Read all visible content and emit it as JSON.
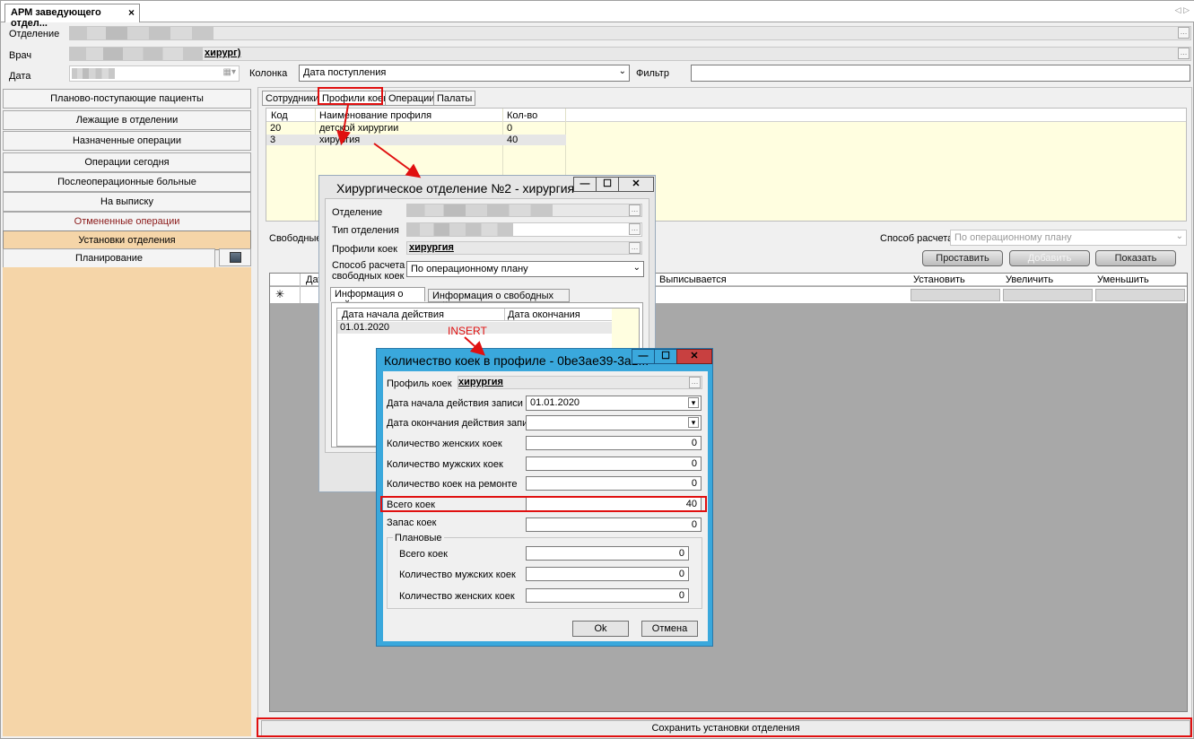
{
  "tab": {
    "title": "АРМ заведующего отдел...",
    "close": "×",
    "nav_arrows": "◁ ▷"
  },
  "filters": {
    "department_label": "Отделение",
    "doctor_label": "Врач",
    "doctor_value": "хирург)",
    "date_label": "Дата",
    "column_label": "Колонка",
    "column_value": "Дата поступления",
    "filter_label": "Фильтр"
  },
  "nav": [
    {
      "label": "Планово-поступающие пациенты"
    },
    {
      "label": "Лежащие в отделении"
    },
    {
      "label": "Назначенные операции"
    },
    {
      "label": "Операции сегодня"
    },
    {
      "label": "Послеоперационные больные"
    },
    {
      "label": "На выписку"
    },
    {
      "label": "Отмененные операции"
    },
    {
      "label": "Установки отделения"
    },
    {
      "label": "Планирование"
    }
  ],
  "subtabs": [
    "Сотрудники",
    "Профили коек",
    "Операции",
    "Палаты"
  ],
  "profiles_grid": {
    "headers": [
      "Код",
      "Наименование профиля",
      "Кол-во"
    ],
    "rows": [
      [
        "20",
        "детской хирургии",
        "0"
      ],
      [
        "3",
        "хирургия",
        "40"
      ]
    ]
  },
  "free_beds": {
    "label": "Свободные н",
    "calc_label": "Способ расчета",
    "calc_value": "По операционному плану",
    "buttons": [
      "Проставить",
      "Добавить",
      "Показать"
    ],
    "headers": [
      "Дат",
      "Выписывается",
      "Установить",
      "Увеличить",
      "Уменьшить"
    ],
    "new_row_marker": "✳"
  },
  "save_button": "Сохранить установки отделения",
  "dialog1": {
    "title": "Хирургическое отделение №2 - хирургия",
    "dept_label": "Отделение",
    "dept_type_label": "Тип отделения",
    "profile_label": "Профили коек",
    "profile_value": "хирургия",
    "calc_label_1": "Способ расчета",
    "calc_label_2": "свободных коек",
    "calc_value": "По операционному плану",
    "tabs": [
      "Информация о койках",
      "Информация о свободных койках"
    ],
    "grid_headers": [
      "Дата начала действия",
      "Дата окончания"
    ],
    "grid_rows": [
      [
        "01.01.2020",
        ""
      ]
    ]
  },
  "annotation": "INSERT",
  "dialog2": {
    "title": "Количество коек в профиле - 0be3ae39-3a1...",
    "profile_label": "Профиль коек",
    "profile_value": "хирургия",
    "start_label": "Дата начала действия записи",
    "start_value": "01.01.2020",
    "end_label": "Дата окончания действия записи",
    "female_label": "Количество женских коек",
    "female_value": "0",
    "male_label": "Количество мужских коек",
    "male_value": "0",
    "repair_label": "Количество коек на ремонте",
    "repair_value": "0",
    "total_label": "Всего коек",
    "total_value": "40",
    "reserve_label": "Запас коек",
    "reserve_value": "0",
    "planned_group": "Плановые",
    "p_total_label": "Всего коек",
    "p_total_value": "0",
    "p_male_label": "Количество мужских коек",
    "p_male_value": "0",
    "p_female_label": "Количество женских коек",
    "p_female_value": "0",
    "ok": "Ok",
    "cancel": "Отмена"
  },
  "colors": {
    "accent_red": "#e01010",
    "dialog_border_blue": "#3aa8dc",
    "active_nav": "#f5d5a8",
    "grid_yellow": "#fffee0"
  }
}
